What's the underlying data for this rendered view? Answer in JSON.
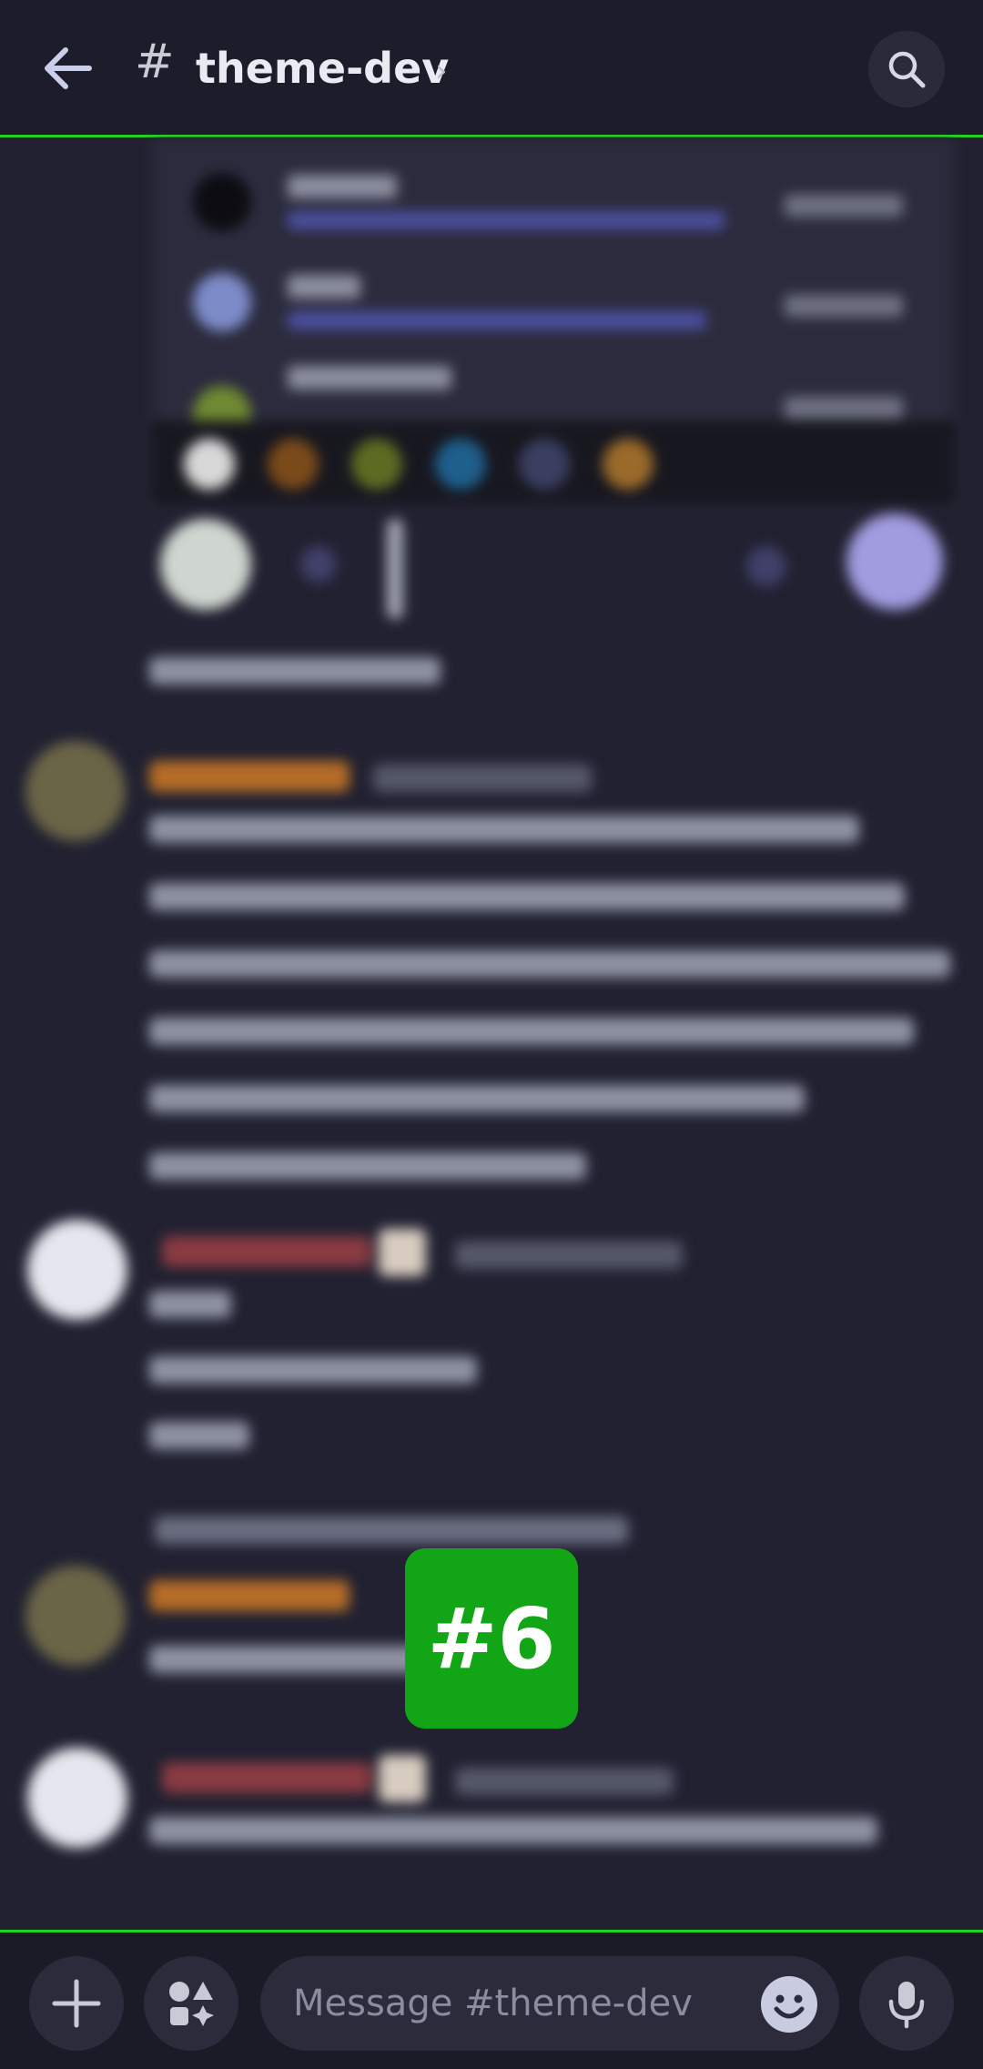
{
  "header": {
    "back_icon": "arrow-left-icon",
    "channel_icon": "hash-icon",
    "hash": "#",
    "channel_name": "theme-dev",
    "chevron": "›",
    "search_icon": "search-icon"
  },
  "messages": {
    "blurred": true
  },
  "overlay": {
    "badge_label": "#6"
  },
  "composer": {
    "add_icon": "plus-icon",
    "apps_icon": "apps-icon",
    "placeholder": "Message #theme-dev",
    "emoji_icon": "emoji-icon",
    "mic_icon": "microphone-icon"
  },
  "colors": {
    "background": "#212131",
    "header_bg": "#1c1c2a",
    "accent_border": "#23d21e",
    "badge": "#12a616"
  }
}
